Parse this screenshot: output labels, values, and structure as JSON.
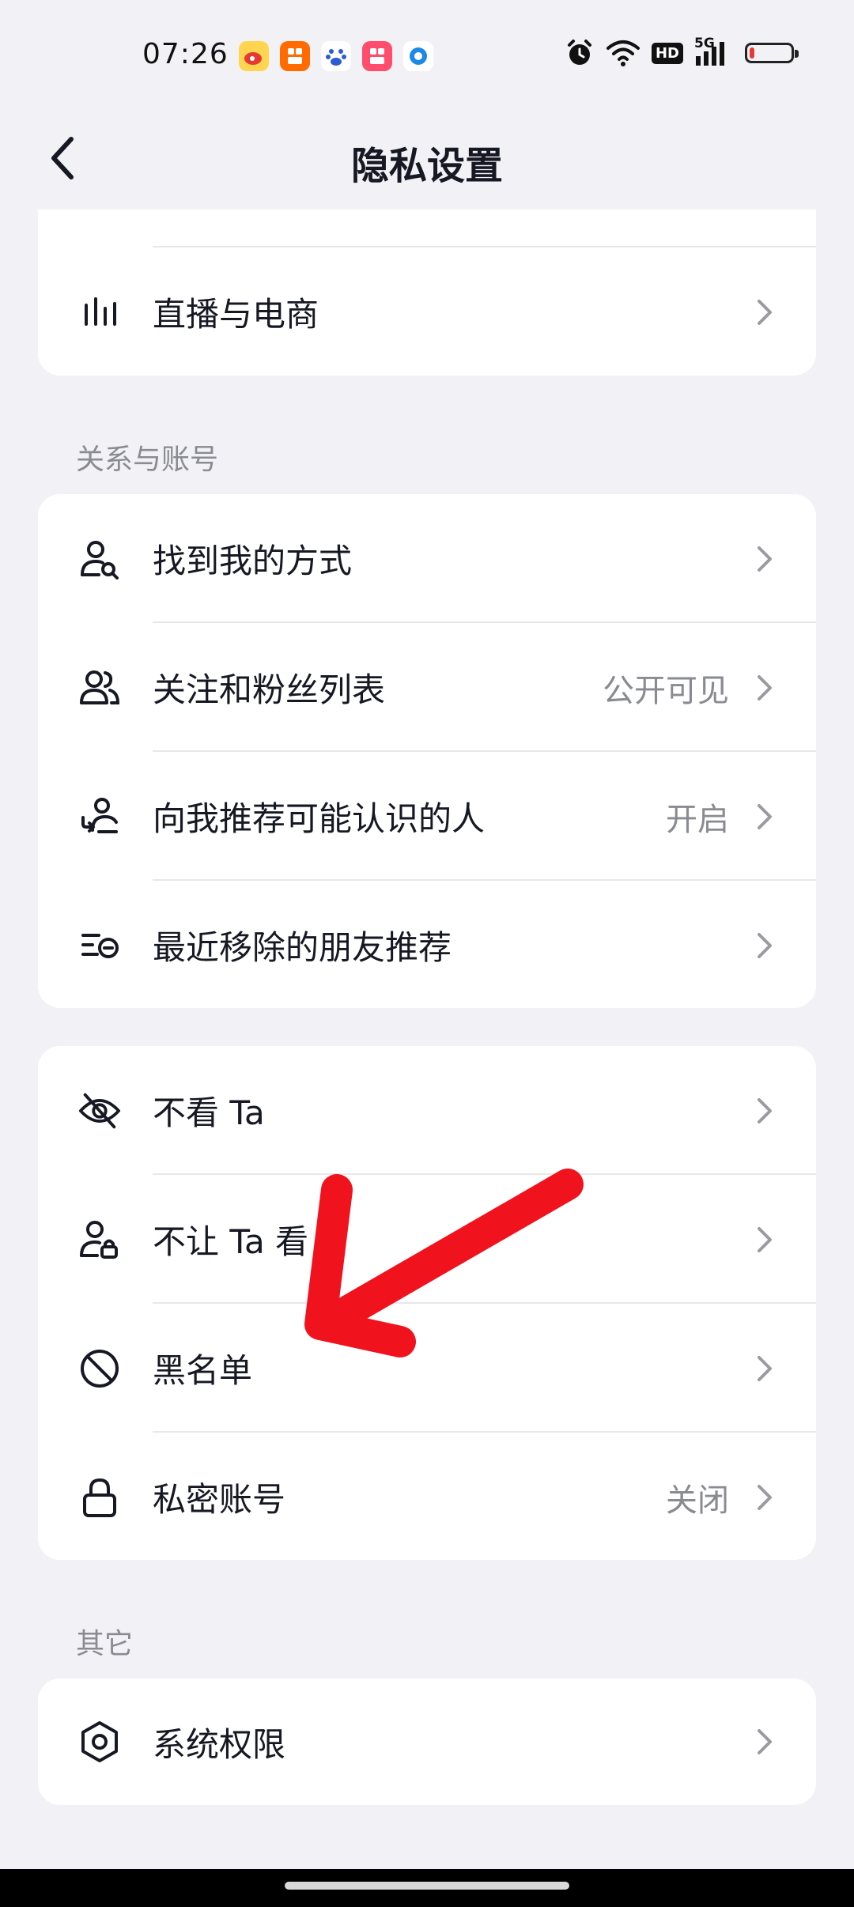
{
  "status_bar": {
    "time": "07:26",
    "network": "5G",
    "hd": "HD",
    "notification_icons": [
      "weibo-icon",
      "app-icon",
      "baidu-icon",
      "app-icon",
      "browser-icon"
    ],
    "battery_color": "#e53935"
  },
  "nav": {
    "title": "隐私设置"
  },
  "top_card": {
    "rows": [
      {
        "label": "直播与电商",
        "value": "",
        "icon": "live-commerce-icon"
      }
    ]
  },
  "section_relations": {
    "title": "关系与账号",
    "rows": [
      {
        "label": "找到我的方式",
        "value": "",
        "icon": "find-me-icon"
      },
      {
        "label": "关注和粉丝列表",
        "value": "公开可见",
        "icon": "followers-icon"
      },
      {
        "label": "向我推荐可能认识的人",
        "value": "开启",
        "icon": "recommend-people-icon"
      },
      {
        "label": "最近移除的朋友推荐",
        "value": "",
        "icon": "removed-recommend-icon"
      }
    ]
  },
  "section_block": {
    "rows": [
      {
        "label": "不看 Ta",
        "value": "",
        "icon": "eye-off-icon"
      },
      {
        "label": "不让 Ta 看",
        "value": "",
        "icon": "user-lock-icon"
      },
      {
        "label": "黑名单",
        "value": "",
        "icon": "block-icon"
      },
      {
        "label": "私密账号",
        "value": "关闭",
        "icon": "lock-icon"
      }
    ]
  },
  "section_other": {
    "title": "其它",
    "rows": [
      {
        "label": "系统权限",
        "value": "",
        "icon": "permissions-icon"
      }
    ]
  },
  "annotation": {
    "arrow_color": "#f0131e",
    "target": "黑名单"
  },
  "colors": {
    "background": "#f2f2f6",
    "card": "#ffffff",
    "text_primary": "#161823",
    "text_secondary": "#8a8b91"
  }
}
